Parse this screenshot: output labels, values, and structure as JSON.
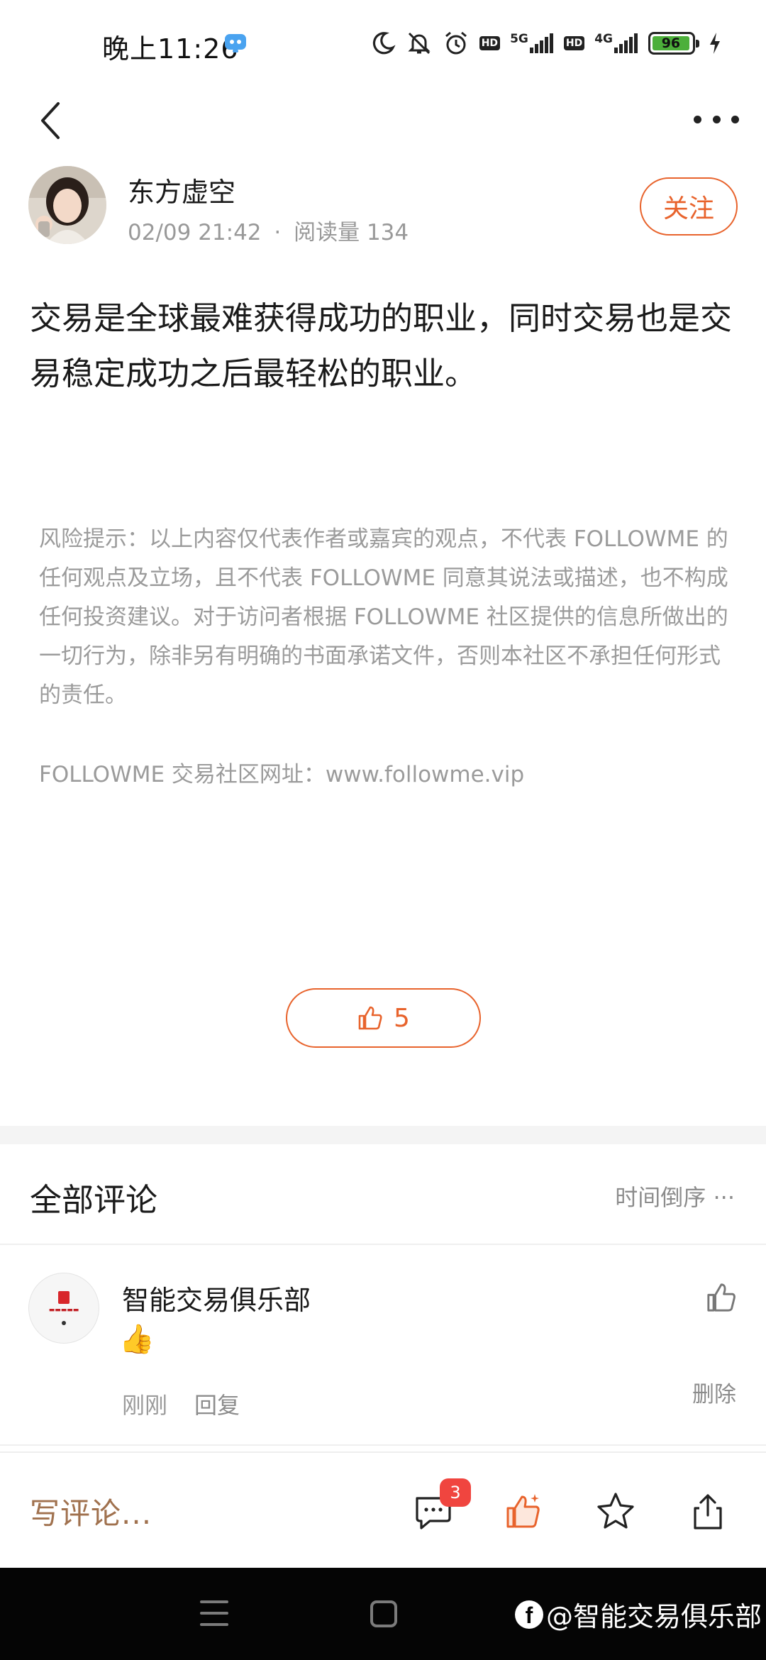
{
  "status_bar": {
    "time": "晚上11:26",
    "network_1": "5G",
    "network_2": "4G",
    "hd_label": "HD",
    "battery": "96",
    "battery_level": 0.96,
    "icons": [
      "moon-icon",
      "mute-icon",
      "alarm-icon",
      "hd-icon",
      "signal-icon",
      "charging-icon"
    ]
  },
  "nav": {
    "back_icon": "back-arrow-icon",
    "more_icon": "more-dots-icon"
  },
  "author": {
    "name": "东方虚空",
    "date": "02/09 21:42",
    "separator": "·",
    "reads": "阅读量 134",
    "follow_label": "关注"
  },
  "post": {
    "content": "交易是全球最难获得成功的职业，同时交易也是交易稳定成功之后最轻松的职业。",
    "risk_notice": "风险提示：以上内容仅代表作者或嘉宾的观点，不代表 FOLLOWME 的任何观点及立场，且不代表 FOLLOWME 同意其说法或描述，也不构成任何投资建议。对于访问者根据 FOLLOWME 社区提供的信息所做出的一切行为，除非另有明确的书面承诺文件，否则本社区不承担任何形式的责任。",
    "site": "FOLLOWME 交易社区网址：www.followme.vip",
    "like_count": "5"
  },
  "comments": {
    "title": "全部评论",
    "sort_label": "时间倒序 ···",
    "items": [
      {
        "author": "智能交易俱乐部",
        "content": "👍",
        "time": "刚刚",
        "reply_label": "回复",
        "delete_label": "删除"
      }
    ]
  },
  "action_bar": {
    "write_placeholder": "写评论...",
    "comment_badge": "3"
  },
  "watermark": {
    "text": "@智能交易俱乐部",
    "logo": "f"
  },
  "colors": {
    "accent": "#e8632c",
    "badge": "#f0453f",
    "muted_text": "#9b9b9b"
  }
}
